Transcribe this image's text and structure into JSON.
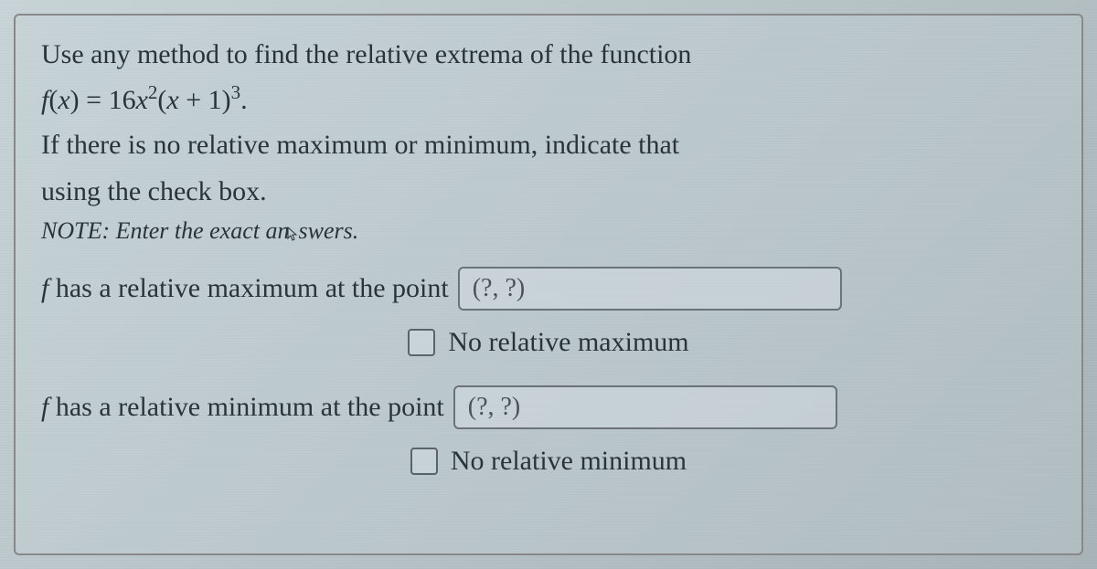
{
  "question": {
    "line1": "Use any method to find the relative extrema of the function",
    "function_prefix": "f(x) = ",
    "function_body": "16x²(x + 1)³.",
    "condition_line1": "If there is no relative maximum or minimum, indicate that",
    "condition_line2": "using the check box.",
    "note": "NOTE: Enter the exact answers."
  },
  "answers": {
    "max_label_prefix": "f ",
    "max_label": "has a relative maximum at the point",
    "max_placeholder": "(?, ?)",
    "no_max_label": "No relative maximum",
    "min_label_prefix": "f ",
    "min_label": "has a relative minimum at the point",
    "min_placeholder": "(?, ?)",
    "no_min_label": "No relative minimum"
  }
}
